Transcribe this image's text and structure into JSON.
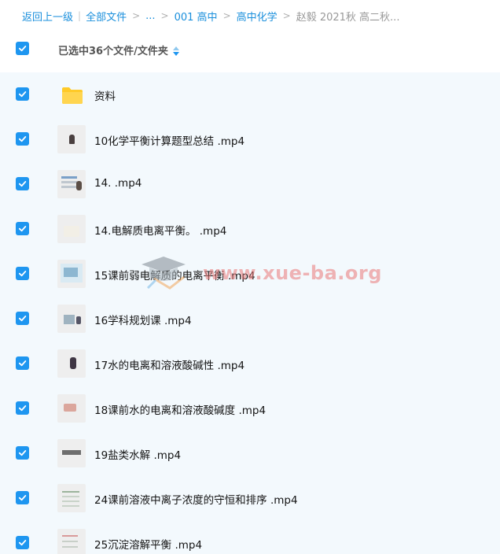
{
  "breadcrumb": {
    "back": "返回上一级",
    "all_files": "全部文件",
    "ellipsis": "...",
    "level1": "001 高中",
    "level2": "高中化学",
    "current": "赵毅 2021秋 高二秋..."
  },
  "header": {
    "selected_label": "已选中36个文件/文件夹"
  },
  "files": [
    {
      "name": "资料",
      "type": "folder",
      "checked": true
    },
    {
      "name": "10化学平衡计算题型总结 .mp4",
      "type": "video",
      "checked": true
    },
    {
      "name": "14. .mp4",
      "type": "video",
      "checked": true
    },
    {
      "name": "14.电解质电离平衡。 .mp4",
      "type": "video",
      "checked": true
    },
    {
      "name": "15课前弱电解质的电离平衡 .mp4",
      "type": "video",
      "checked": true
    },
    {
      "name": "16学科规划课 .mp4",
      "type": "video",
      "checked": true
    },
    {
      "name": "17水的电离和溶液酸碱性 .mp4",
      "type": "video",
      "checked": true
    },
    {
      "name": "18课前水的电离和溶液酸碱度 .mp4",
      "type": "video",
      "checked": true
    },
    {
      "name": "19盐类水解 .mp4",
      "type": "video",
      "checked": true
    },
    {
      "name": "24课前溶液中离子浓度的守恒和排序 .mp4",
      "type": "video",
      "checked": true
    },
    {
      "name": "25沉淀溶解平衡 .mp4",
      "type": "video",
      "checked": true
    }
  ],
  "watermark": {
    "text": "www.xue-ba.org"
  },
  "colors": {
    "accent": "#1e96f0",
    "link": "#1a8fdc",
    "list_background": "#f3f9fd",
    "folder": "#ffca28"
  }
}
